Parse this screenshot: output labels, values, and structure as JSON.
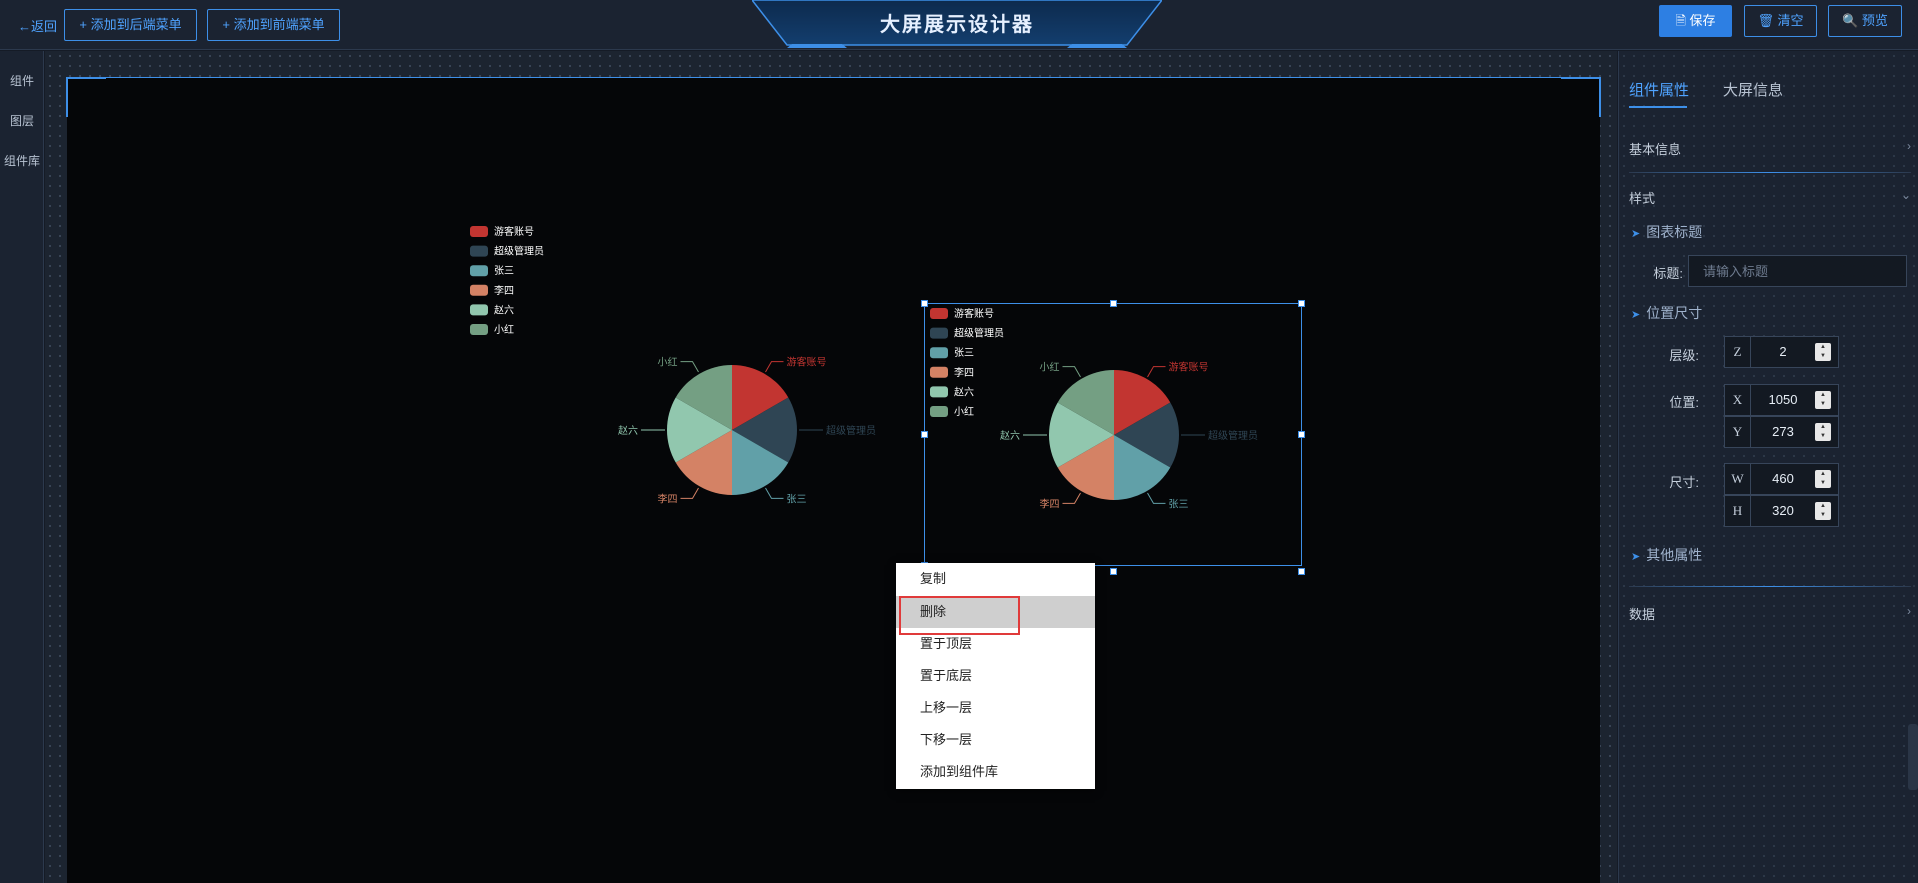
{
  "header": {
    "back_label": "←返回",
    "add_back_menu": "+ 添加到后端菜单",
    "add_front_menu": "+ 添加到前端菜单",
    "title": "大屏展示设计器",
    "save": "🗎 保存",
    "clear": "🗑 清空",
    "preview": "🔍 预览"
  },
  "sidebar": {
    "items": [
      {
        "label": "组件"
      },
      {
        "label": "图层"
      },
      {
        "label": "组件库"
      }
    ]
  },
  "colors": {
    "accent": "#3d8fe8",
    "background": "#151b26",
    "canvas": "#050608",
    "pie": [
      "#c23531",
      "#2f4554",
      "#61a0a8",
      "#d48265",
      "#91c7ae",
      "#749f83"
    ]
  },
  "charts": {
    "legend": [
      "游客账号",
      "超级管理员",
      "张三",
      "李四",
      "赵六",
      "小红"
    ],
    "chart_data": [
      {
        "type": "pie",
        "categories": [
          "游客账号",
          "超级管理员",
          "张三",
          "李四",
          "赵六",
          "小红"
        ],
        "values": [
          1,
          1,
          1,
          1,
          1,
          1
        ],
        "legend_position": "top-left"
      },
      {
        "type": "pie",
        "categories": [
          "游客账号",
          "超级管理员",
          "张三",
          "李四",
          "赵六",
          "小红"
        ],
        "values": [
          1,
          1,
          1,
          1,
          1,
          1
        ],
        "legend_position": "top-left"
      }
    ]
  },
  "context_menu": {
    "items": [
      {
        "label": "复制"
      },
      {
        "label": "删除"
      },
      {
        "label": "置于顶层"
      },
      {
        "label": "置于底层"
      },
      {
        "label": "上移一层"
      },
      {
        "label": "下移一层"
      },
      {
        "label": "添加到组件库"
      }
    ],
    "highlighted": "删除"
  },
  "panel": {
    "tabs": [
      "组件属性",
      "大屏信息"
    ],
    "active_tab": "组件属性",
    "basic_info": "基本信息",
    "style": "样式",
    "chart_title_section": "图表标题",
    "title_label": "标题:",
    "title_placeholder": "请输入标题",
    "position_size_section": "位置尺寸",
    "layer_label": "层级:",
    "position_label": "位置:",
    "size_label": "尺寸:",
    "z": {
      "prefix": "Z",
      "value": "2"
    },
    "x": {
      "prefix": "X",
      "value": "1050"
    },
    "y": {
      "prefix": "Y",
      "value": "273"
    },
    "w": {
      "prefix": "W",
      "value": "460"
    },
    "h": {
      "prefix": "H",
      "value": "320"
    },
    "other_props": "其他属性",
    "data": "数据"
  }
}
